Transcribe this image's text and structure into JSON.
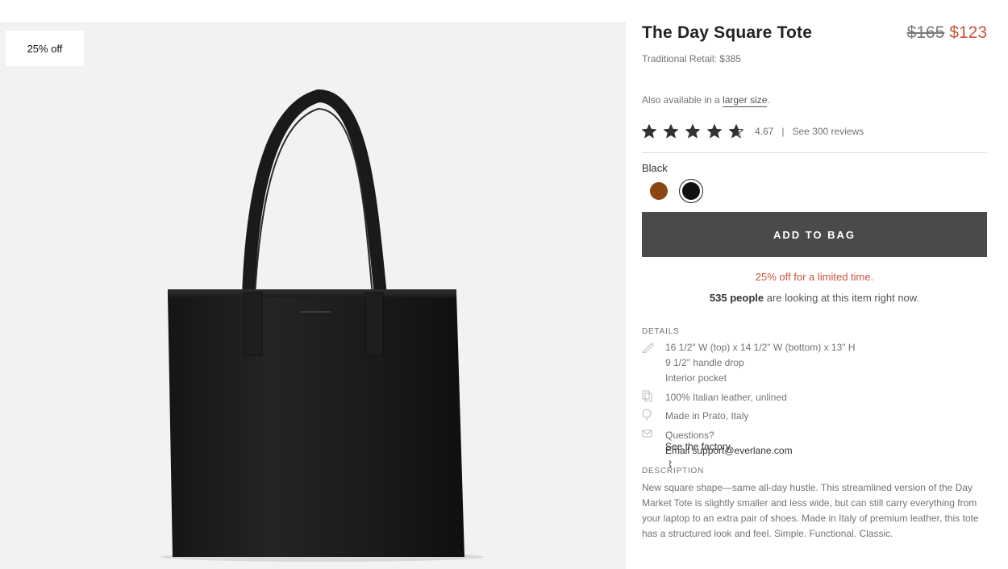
{
  "badge": "25% off",
  "product": {
    "title": "The Day Square Tote",
    "price_old": "$165",
    "price_new": "$123",
    "traditional_retail": "Traditional Retail: $385",
    "also_prefix": "Also available in a ",
    "also_link": "larger size",
    "also_suffix": "."
  },
  "rating": {
    "stars": 4.67,
    "value": "4.67",
    "separator": "|",
    "reviews_link": "See 300 reviews"
  },
  "color": {
    "selected_name": "Black",
    "swatches": [
      {
        "name": "Brown",
        "hex": "#8b4513",
        "selected": false
      },
      {
        "name": "Black",
        "hex": "#111111",
        "selected": true
      }
    ]
  },
  "cta": {
    "add_to_bag": "ADD TO BAG"
  },
  "promo": "25% off for a limited time.",
  "looking": {
    "count": "535 people",
    "suffix": " are looking at this item right now."
  },
  "details": {
    "label": "DETAILS",
    "dimensions": [
      "16 1/2\" W (top) x 14 1/2\" W (bottom) x 13\" H",
      "9 1/2\" handle drop",
      "Interior pocket"
    ],
    "material": "100% Italian leather, unlined",
    "origin": "Made in Prato, Italy",
    "origin_dot": "·",
    "factory_link": "See the factory",
    "questions_label": "Questions?",
    "email_link": "Email support@everlane.com",
    "chevron": "›"
  },
  "description": {
    "label": "DESCRIPTION",
    "text": "New square shape—same all-day hustle. This streamlined version of the Day Market Tote is slightly smaller and less wide, but can still carry everything from your laptop to an extra pair of shoes. Made in Italy of premium leather, this tote has a structured look and feel. Simple. Functional. Classic."
  },
  "colors": {
    "accent_sale": "#c8553d",
    "button_bg": "#4a4a48",
    "gallery_bg": "#f2f2f2"
  }
}
